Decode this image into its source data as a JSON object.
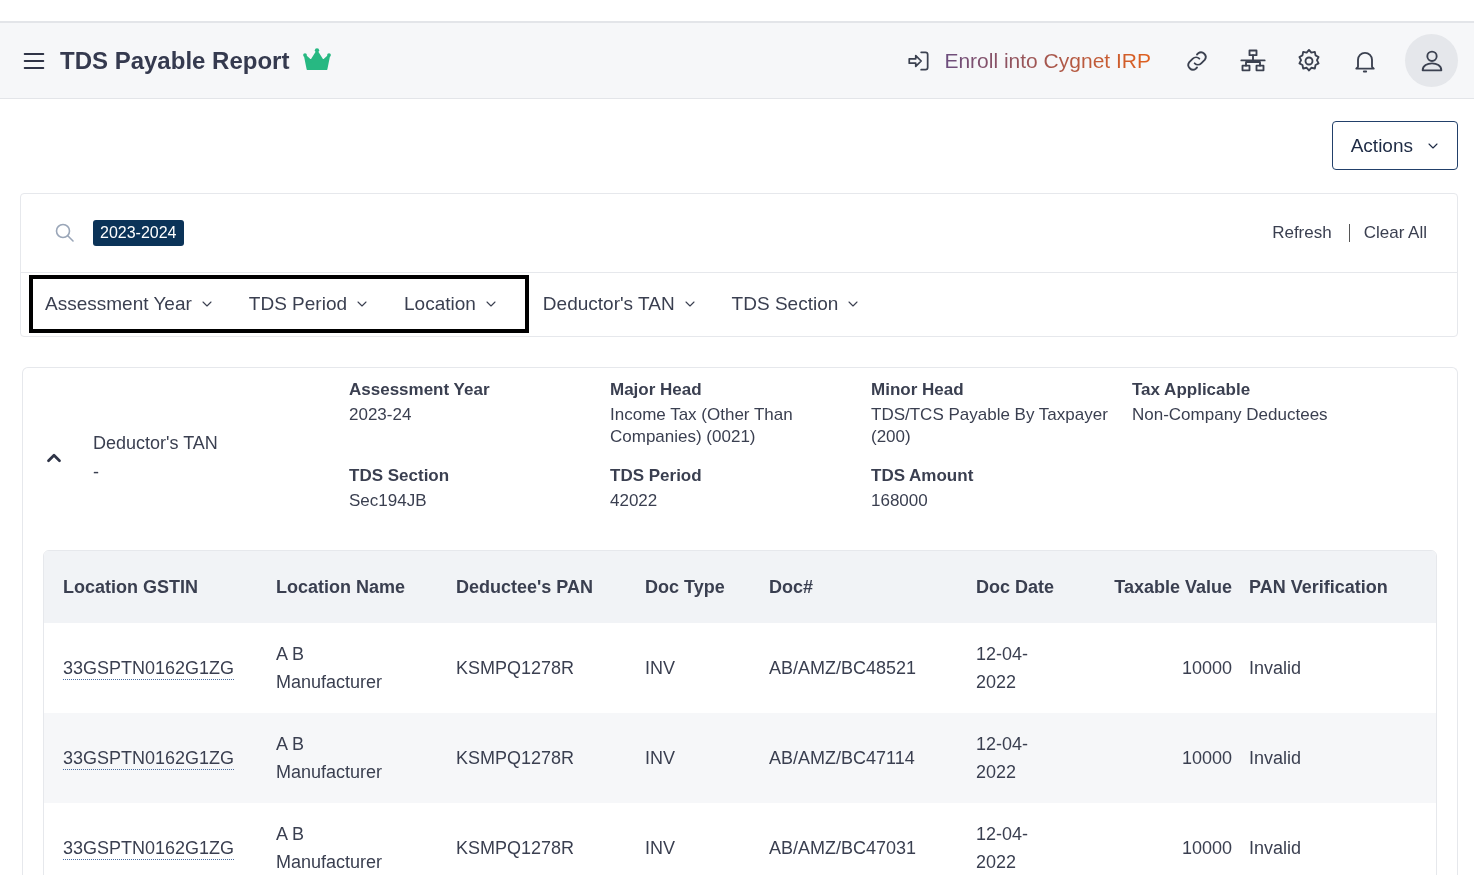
{
  "header": {
    "title": "TDS Payable Report",
    "enroll_link": "Enroll into Cygnet IRP"
  },
  "actions_button": "Actions",
  "filter_bar": {
    "search_chip": "2023-2024",
    "refresh": "Refresh",
    "clear_all": "Clear All",
    "filters": [
      {
        "label": "Assessment Year",
        "highlighted": true
      },
      {
        "label": "TDS Period",
        "highlighted": true
      },
      {
        "label": "Location",
        "highlighted": true
      },
      {
        "label": "Deductor's TAN",
        "highlighted": false
      },
      {
        "label": "TDS Section",
        "highlighted": false
      }
    ]
  },
  "summary": {
    "expanded": true,
    "deductor_tan_label": "Deductor's TAN",
    "deductor_tan_value": "-",
    "fields": [
      {
        "label": "Assessment Year",
        "value": "2023-24"
      },
      {
        "label": "Major Head",
        "value": "Income Tax (Other Than Companies) (0021)"
      },
      {
        "label": "Minor Head",
        "value": "TDS/TCS Payable By Taxpayer (200)"
      },
      {
        "label": "Tax Applicable",
        "value": "Non-Company Deductees"
      },
      {
        "label": "TDS Section",
        "value": "Sec194JB"
      },
      {
        "label": "TDS Period",
        "value": "42022"
      },
      {
        "label": "TDS Amount",
        "value": "168000"
      }
    ]
  },
  "table": {
    "columns": [
      "Location GSTIN",
      "Location Name",
      "Deductee's PAN",
      "Doc Type",
      "Doc#",
      "Doc Date",
      "Taxable Value",
      "PAN Verification"
    ],
    "rows": [
      [
        "33GSPTN0162G1ZG",
        "A B Manufacturer",
        "KSMPQ1278R",
        "INV",
        "AB/AMZ/BC48521",
        "12-04-2022",
        "10000",
        "Invalid"
      ],
      [
        "33GSPTN0162G1ZG",
        "A B Manufacturer",
        "KSMPQ1278R",
        "INV",
        "AB/AMZ/BC47114",
        "12-04-2022",
        "10000",
        "Invalid"
      ],
      [
        "33GSPTN0162G1ZG",
        "A B Manufacturer",
        "KSMPQ1278R",
        "INV",
        "AB/AMZ/BC47031",
        "12-04-2022",
        "10000",
        "Invalid"
      ]
    ]
  }
}
